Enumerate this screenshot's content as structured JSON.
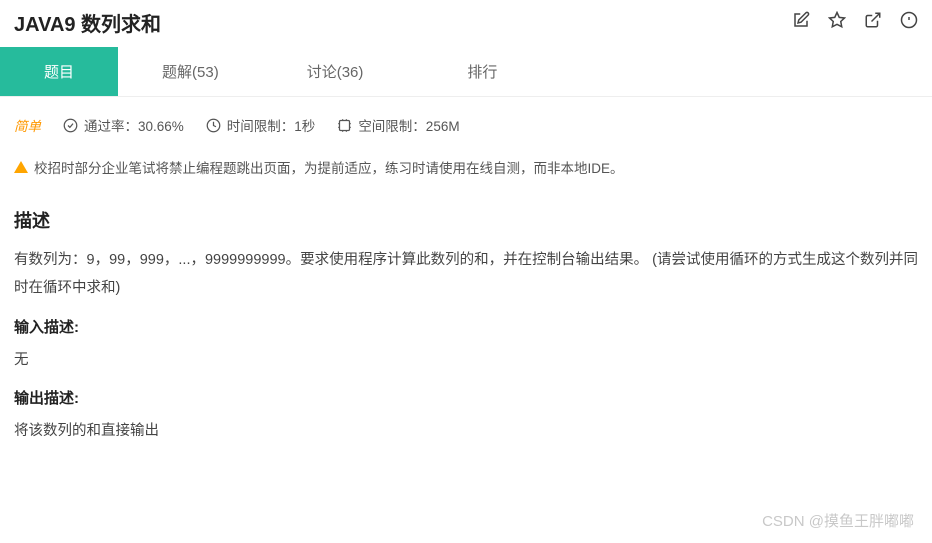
{
  "header": {
    "title": "JAVA9  数列求和"
  },
  "tabs": {
    "problem": "题目",
    "solution": "题解(53)",
    "discuss": "讨论(36)",
    "rank": "排行"
  },
  "meta": {
    "difficulty": "简单",
    "pass_rate_label": "通过率：30.66%",
    "time_limit_label": "时间限制：1秒",
    "space_limit_label": "空间限制：256M"
  },
  "warning_text": "校招时部分企业笔试将禁止编程题跳出页面，为提前适应，练习时请使用在线自测，而非本地IDE。",
  "description": {
    "heading": "描述",
    "body": "有数列为：9，99，999，...，9999999999。要求使用程序计算此数列的和，并在控制台输出结果。  (请尝试使用循环的方式生成这个数列并同时在循环中求和)"
  },
  "input": {
    "heading": "输入描述:",
    "body": "无"
  },
  "output": {
    "heading": "输出描述:",
    "body": "将该数列的和直接输出"
  },
  "watermark": "CSDN @摸鱼王胖嘟嘟"
}
